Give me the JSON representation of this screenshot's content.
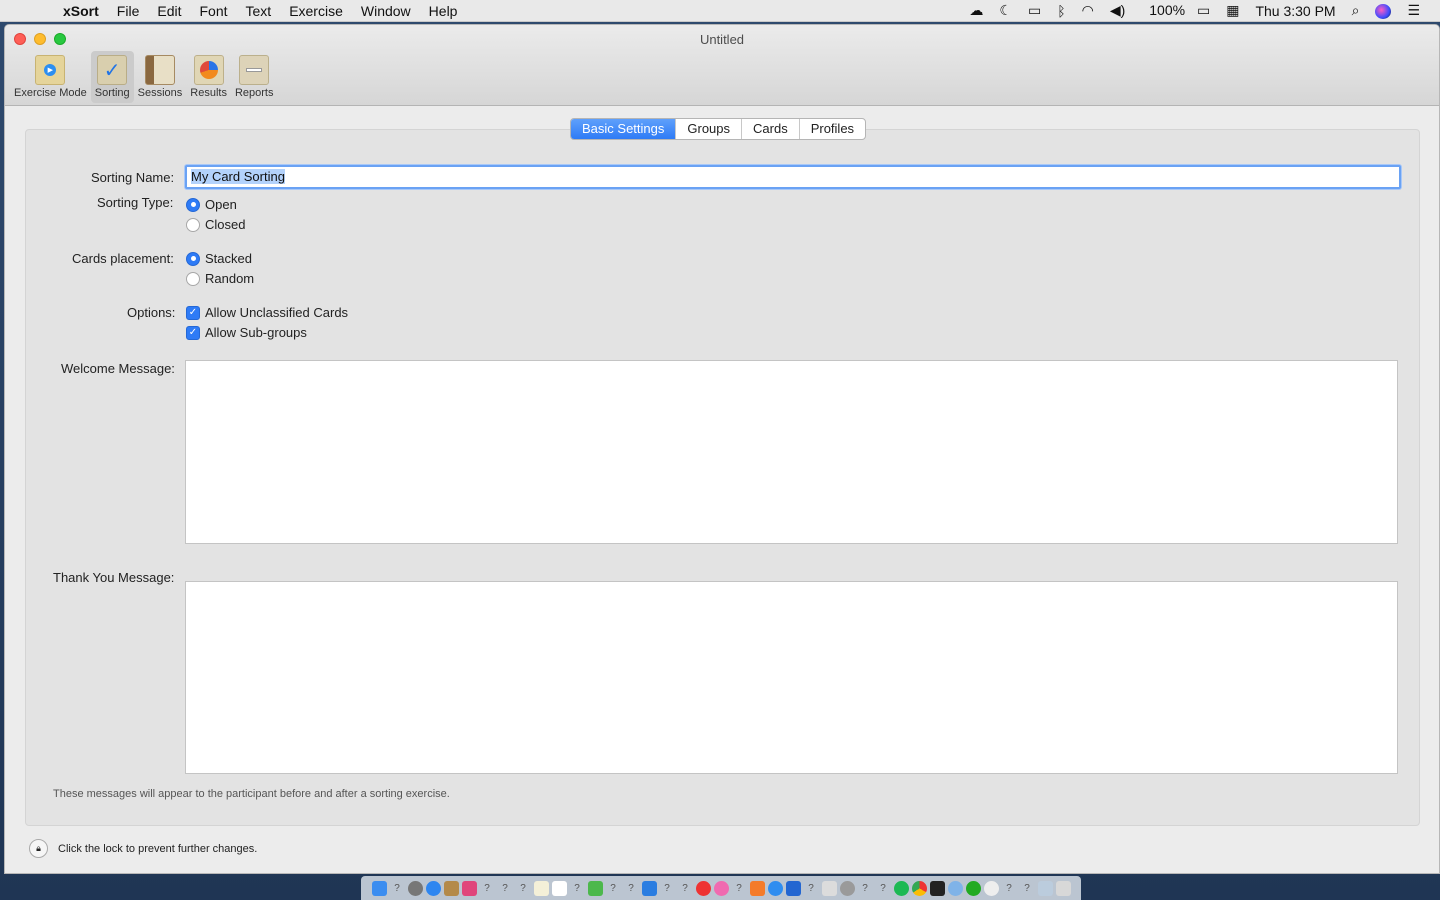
{
  "menubar": {
    "app_name": "xSort",
    "items": [
      "File",
      "Edit",
      "Font",
      "Text",
      "Exercise",
      "Window",
      "Help"
    ],
    "battery": "100%",
    "clock": "Thu 3:30 PM"
  },
  "window": {
    "title": "Untitled",
    "toolbar": [
      {
        "label": "Exercise Mode",
        "icon": "exercise-mode-icon"
      },
      {
        "label": "Sorting",
        "icon": "sorting-icon",
        "active": true
      },
      {
        "label": "Sessions",
        "icon": "sessions-icon"
      },
      {
        "label": "Results",
        "icon": "results-icon"
      },
      {
        "label": "Reports",
        "icon": "reports-icon"
      }
    ]
  },
  "tabs": [
    "Basic Settings",
    "Groups",
    "Cards",
    "Profiles"
  ],
  "active_tab": "Basic Settings",
  "form": {
    "sorting_name_label": "Sorting Name:",
    "sorting_name_value": "My Card Sorting",
    "sorting_type_label": "Sorting Type:",
    "sorting_type_options": [
      "Open",
      "Closed"
    ],
    "sorting_type_selected": "Open",
    "cards_placement_label": "Cards placement:",
    "cards_placement_options": [
      "Stacked",
      "Random"
    ],
    "cards_placement_selected": "Stacked",
    "options_label": "Options:",
    "options": [
      "Allow Unclassified Cards",
      "Allow Sub-groups"
    ],
    "welcome_label": "Welcome Message:",
    "welcome_value": "",
    "thankyou_label": "Thank You Message:",
    "thankyou_value": "",
    "note": "These messages will appear to the participant before and after a sorting exercise."
  },
  "lock_text": "Click the lock to prevent further changes.",
  "colors": {
    "accent": "#2e7bf6"
  }
}
